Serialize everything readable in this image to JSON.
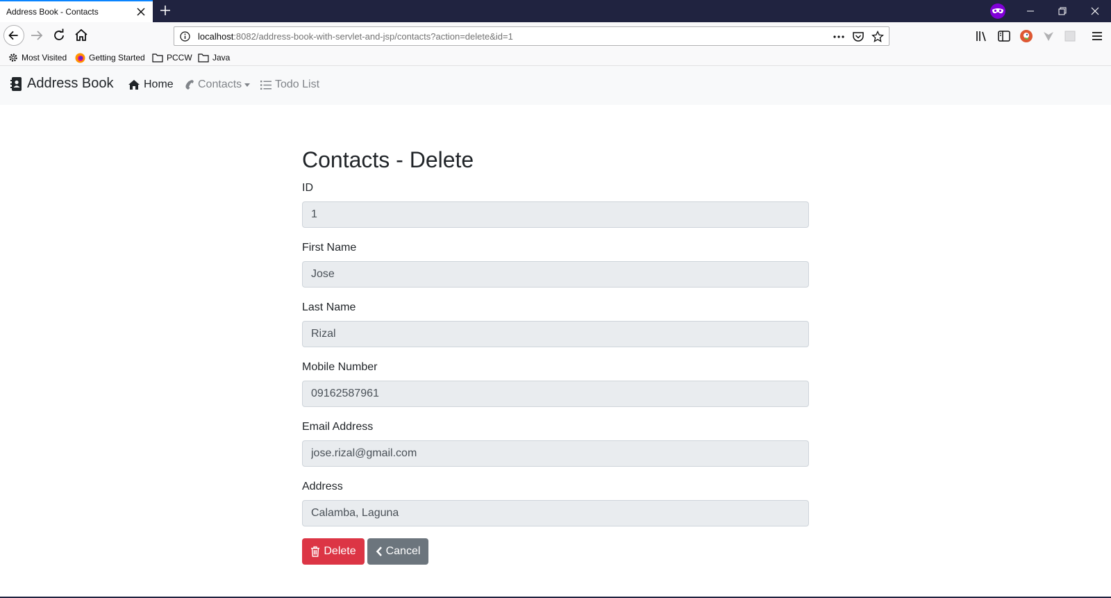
{
  "browser": {
    "tab_title": "Address Book - Contacts",
    "url_host": "localhost",
    "url_rest": ":8082/address-book-with-servlet-and-jsp/contacts?action=delete&id=1",
    "bookmarks": [
      "Most Visited",
      "Getting Started",
      "PCCW",
      "Java"
    ],
    "accent_color": "#0a84ff",
    "tabstrip_color": "#202340"
  },
  "app": {
    "brand": "Address Book",
    "nav": {
      "home": "Home",
      "contacts": "Contacts",
      "todo": "Todo List"
    }
  },
  "form": {
    "title": "Contacts - Delete",
    "fields": {
      "id": {
        "label": "ID",
        "value": "1"
      },
      "first_name": {
        "label": "First Name",
        "value": "Jose"
      },
      "last_name": {
        "label": "Last Name",
        "value": "Rizal"
      },
      "mobile": {
        "label": "Mobile Number",
        "value": "09162587961"
      },
      "email": {
        "label": "Email Address",
        "value": "jose.rizal@gmail.com"
      },
      "address": {
        "label": "Address",
        "value": "Calamba, Laguna"
      }
    },
    "buttons": {
      "delete": "Delete",
      "cancel": "Cancel"
    },
    "colors": {
      "delete": "#dc3545",
      "cancel": "#6c757d"
    }
  },
  "icons": [
    "close-icon",
    "plus-icon",
    "private-mask-icon",
    "minimize-icon",
    "restore-icon",
    "back-arrow-icon",
    "forward-arrow-icon",
    "reload-icon",
    "home-icon",
    "info-icon",
    "more-icon",
    "pocket-icon",
    "star-icon",
    "library-icon",
    "sidebar-icon",
    "duckduckgo-icon",
    "vpn-icon",
    "extension-icon",
    "hamburger-menu-icon",
    "gear-icon",
    "firefox-icon",
    "folder-icon",
    "address-book-icon",
    "phone-icon",
    "list-icon",
    "trash-icon",
    "chevron-left-icon"
  ]
}
